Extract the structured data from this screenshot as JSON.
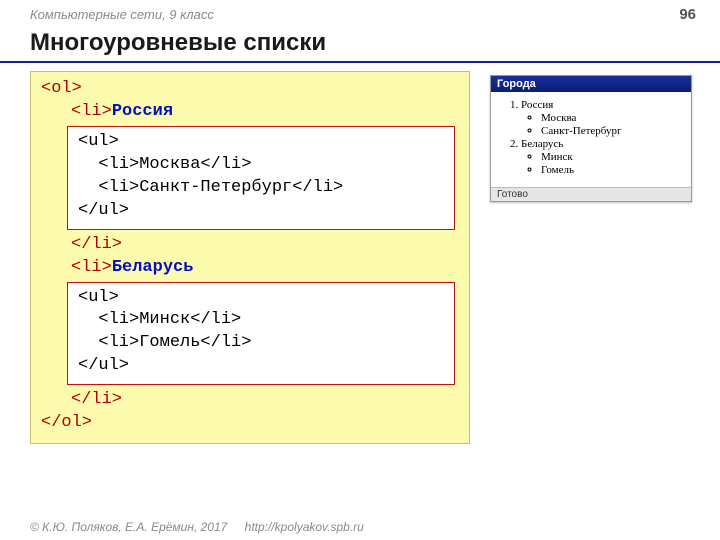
{
  "header": {
    "course": "Компьютерные сети, 9 класс",
    "page": "96"
  },
  "title": "Многоуровневые списки",
  "code": {
    "ol_open": "<ol>",
    "li_open": "<li>",
    "li_close": "</li>",
    "ol_close": "</ol>",
    "country1": "Россия",
    "country2": "Беларусь",
    "box1_l1": "<ul>",
    "box1_l2": "  <li>Москва</li>",
    "box1_l3": "  <li>Санкт-Петербург</li>",
    "box1_l4": "</ul>",
    "box2_l1": "<ul>",
    "box2_l2": "  <li>Минск</li>",
    "box2_l3": "  <li>Гомель</li>",
    "box2_l4": "</ul>"
  },
  "preview": {
    "win_title": "Города",
    "item1": "Россия",
    "sub1a": "Москва",
    "sub1b": "Санкт-Петербург",
    "item2": "Беларусь",
    "sub2a": "Минск",
    "sub2b": "Гомель",
    "status": "Готово"
  },
  "footer": {
    "copyright": "© К.Ю. Поляков, Е.А. Ерёмин, 2017",
    "url": "http://kpolyakov.spb.ru"
  }
}
